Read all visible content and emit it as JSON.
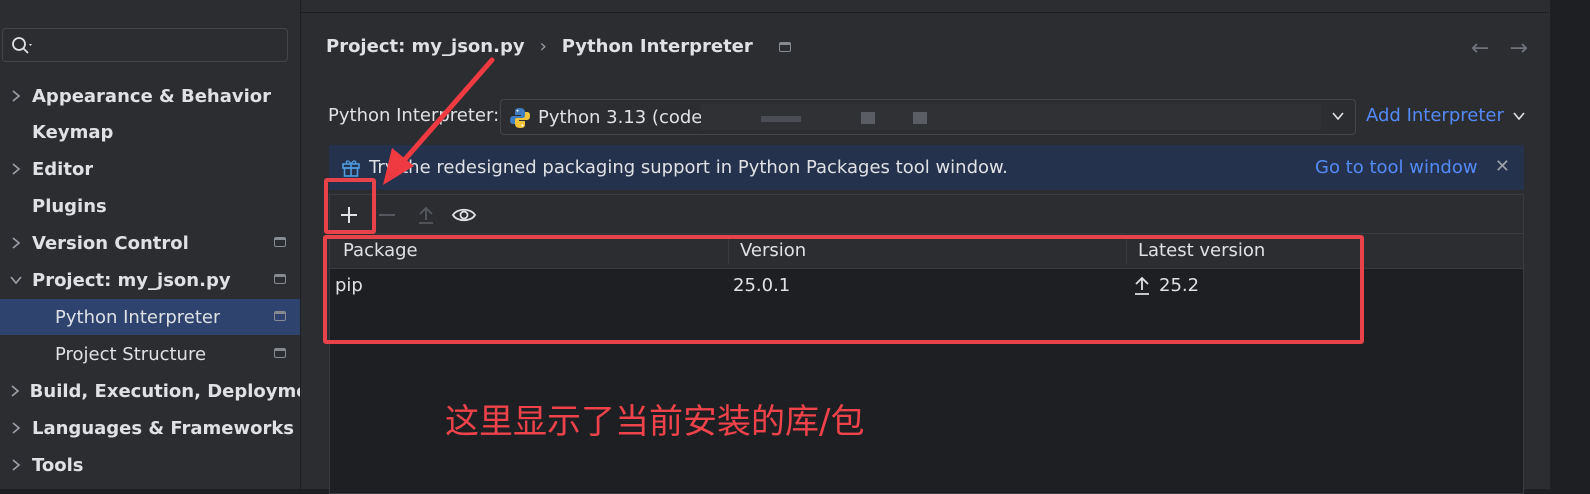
{
  "sidebar": {
    "search_placeholder": "",
    "items": [
      {
        "label": "Appearance & Behavior",
        "expandable": true,
        "expanded": false
      },
      {
        "label": "Keymap",
        "expandable": false
      },
      {
        "label": "Editor",
        "expandable": true,
        "expanded": false
      },
      {
        "label": "Plugins",
        "expandable": false
      },
      {
        "label": "Version Control",
        "expandable": true,
        "expanded": false
      },
      {
        "label": "Project: my_json.py",
        "expandable": true,
        "expanded": true
      },
      {
        "label": "Python Interpreter",
        "child": true,
        "selected": true
      },
      {
        "label": "Project Structure",
        "child": true
      },
      {
        "label": "Build, Execution, Deploymen",
        "expandable": true,
        "expanded": false
      },
      {
        "label": "Languages & Frameworks",
        "expandable": true,
        "expanded": false
      },
      {
        "label": "Tools",
        "expandable": true,
        "expanded": false
      }
    ]
  },
  "breadcrumb": {
    "parent": "Project: my_json.py",
    "separator": "›",
    "current": "Python Interpreter"
  },
  "nav": {
    "back_icon": "arrow-left-icon",
    "forward_icon": "arrow-right-icon"
  },
  "interpreter": {
    "label": "Python Interpreter:",
    "value": "Python 3.13 (code",
    "add_label": "Add Interpreter"
  },
  "banner": {
    "text": "Try the redesigned packaging support in Python Packages tool window.",
    "link": "Go to tool window",
    "close": "✕"
  },
  "packages": {
    "columns": [
      "Package",
      "Version",
      "Latest version"
    ],
    "rows": [
      {
        "package": "pip",
        "version": "25.0.1",
        "latest": "25.2"
      }
    ]
  },
  "annotation": {
    "text": "这里显示了当前安装的库/包"
  },
  "colors": {
    "accent": "#548af7",
    "annotation": "#e8424a",
    "selection": "#2e436e"
  }
}
